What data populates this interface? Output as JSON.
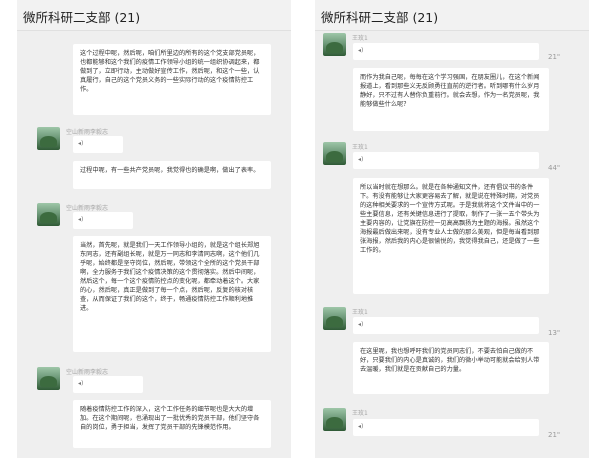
{
  "left": {
    "title": "微所科研二支部 (21)",
    "messages": [
      {
        "text": "这个过程中呢，然后呢，咱们所里边的所有的这个党支部党员呢，也都能够和这个我们的疫情工作领导小组的统一组织协调起来，都做到了，立即行动，主动做好宣传工作，然后呢，和这个一些，认真履行，自己的这个党员义务的一些实际行动的这个疫情防控工作。"
      },
      {
        "sender": "空山新雨李毅志",
        "voice_icon": "◂)",
        "text": "过程中呢，有一些共产党员呢，我觉得也的确是啊，做出了表率。"
      },
      {
        "sender": "空山新雨李毅志",
        "voice_icon": "◂)",
        "text": "当然，首先呢，就是我们一天工作领导小组的，就是这个组长郑旭东同志，还有副组长呢，就是万一同志和李清同志啊，这个他们几乎呢，始终都是坚守岗位，然后呢，带领这个全所的这个党员干部啊，全力服务于我们这个疫情决策的这个贯彻落实。然后中间呢，然后这个，每一个这个疫情防控点的变化呢，都牵动着这个。大家的心，然后呢，真正是做到了每一个点，然后呢，反复的核对核查，从而保证了我们的这个，终于，畅通疫情防控工作顺利地推进。"
      },
      {
        "sender": "空山新雨李毅志",
        "voice_icon": "◂)",
        "text": "随着疫情防控工作的深入，这个工作任务的细节呢也是大大的增加。在这个期间呢，也涌现出了一批优秀的党员干部，他们坚守各自的岗位，勇于担当，发挥了党员干部的先锋模范作用。"
      }
    ]
  },
  "right": {
    "title": "微所科研二支部 (21)",
    "messages": [
      {
        "sender": "王玫1",
        "duration": "21\"",
        "voice_icon": "◂)",
        "text": "而作为我自己呢，每每在这个学习强国，在朋友圈儿，在这个新闻报道上，看到那些义无反顾勇往直前的逆行者。听到哪有什么岁月静好，只不过有人替你负重前行。就会去想，作为一名党员呢，我能够做些什么呢？"
      },
      {
        "sender": "王玫1",
        "duration": "44\"",
        "voice_icon": "◂)",
        "text": "所以当时就在想那么。就是在各种通知文件，还有倡议书的条件下。有没有能够让大家更容易去了解，就是说在特殊时期，对党员的这种相关要求的一个宣传方式呢。于是我就将这个文件当中的一些主要信息，还有关键信息进行了提取，制作了一张一五个带头为主要内容的，让党旗在防控一见高高飘扬为主题的海报。虽然这个海报最后做出来呢，没有专业人士做的那么美观，但是每当看到那张海报，然后我的内心是很愉悦的，我觉得我自己，还是做了一些工作的。"
      },
      {
        "sender": "王玫1",
        "duration": "13\"",
        "voice_icon": "◂)",
        "text": "在这里呢，我也想呼吁我们的党员同志们，不要去怕自己做的不好，只要我们的内心是真诚的，我们的微小举动可能就会给别人带去温暖，我们就是在贡献自己的力量。"
      },
      {
        "sender": "王玫1",
        "duration": "21\"",
        "voice_icon": "◂)"
      }
    ]
  }
}
